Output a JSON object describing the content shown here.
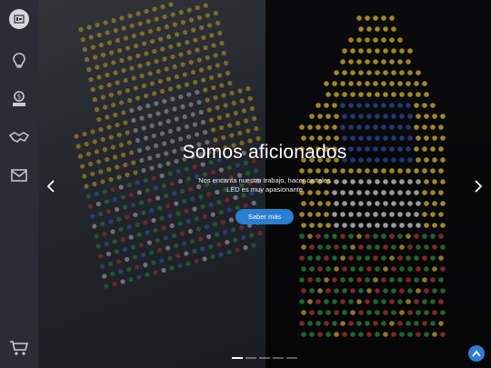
{
  "sidebar": {
    "items": [
      {
        "name": "ideas",
        "icon": "lightbulb-icon"
      },
      {
        "name": "pricing",
        "icon": "money-icon"
      },
      {
        "name": "partners",
        "icon": "handshake-icon"
      },
      {
        "name": "contact",
        "icon": "envelope-icon"
      },
      {
        "name": "cart",
        "icon": "cart-icon"
      }
    ]
  },
  "hero": {
    "title": "Somos aficionados",
    "subtitle": "Nos encanta nuestro trabajo, hacer carteles LED es muy apasionante",
    "cta_label": "Saber más",
    "slide_count": 5,
    "active_slide": 1
  },
  "colors": {
    "accent": "#2a7fd0",
    "sidebar_bg": "#2a2d35",
    "led_yellow": "#e8c428",
    "led_white": "#e8e8ee",
    "led_green": "#2ea44a",
    "led_red": "#d83a3a",
    "led_blue": "#3a6fe8"
  }
}
